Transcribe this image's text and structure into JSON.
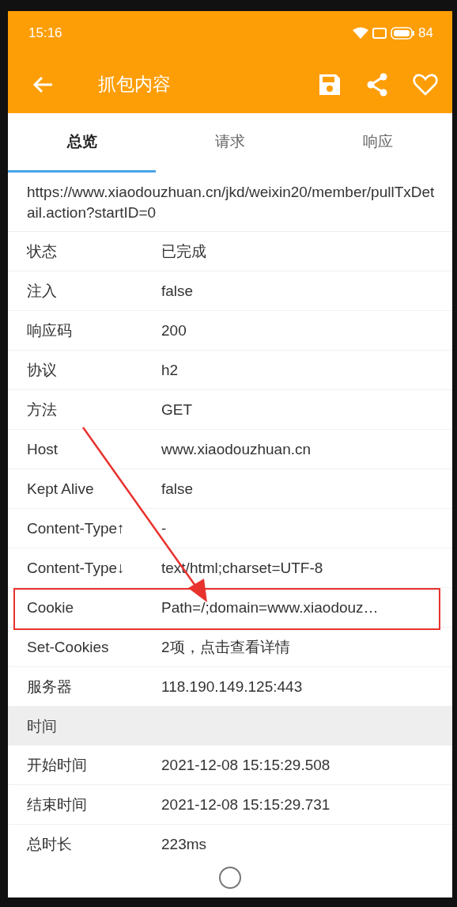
{
  "status_bar": {
    "time": "15:16",
    "battery": "84"
  },
  "toolbar": {
    "title": "抓包内容"
  },
  "tabs": [
    {
      "label": "总览",
      "selected": true
    },
    {
      "label": "请求",
      "selected": false
    },
    {
      "label": "响应",
      "selected": false
    }
  ],
  "url": "https://www.xiaodouzhuan.cn/jkd/weixin20/member/pullTxDetail.action?startID=0",
  "rows": [
    {
      "kind": "field",
      "label": "状态",
      "value": "已完成",
      "highlighted": false
    },
    {
      "kind": "field",
      "label": "注入",
      "value": "false",
      "highlighted": false
    },
    {
      "kind": "field",
      "label": "响应码",
      "value": "200",
      "highlighted": false
    },
    {
      "kind": "field",
      "label": "协议",
      "value": "h2",
      "highlighted": false
    },
    {
      "kind": "field",
      "label": "方法",
      "value": "GET",
      "highlighted": false
    },
    {
      "kind": "field",
      "label": "Host",
      "value": "www.xiaodouzhuan.cn",
      "highlighted": false
    },
    {
      "kind": "field",
      "label": "Kept Alive",
      "value": "false",
      "highlighted": false
    },
    {
      "kind": "field",
      "label": "Content-Type↑",
      "value": "-",
      "highlighted": false
    },
    {
      "kind": "field",
      "label": "Content-Type↓",
      "value": "text/html;charset=UTF-8",
      "highlighted": false
    },
    {
      "kind": "field",
      "label": "Cookie",
      "value": "Path=/;domain=www.xiaodouz…",
      "highlighted": true
    },
    {
      "kind": "field",
      "label": "Set-Cookies",
      "value": "2项，点击查看详情",
      "highlighted": false
    },
    {
      "kind": "field",
      "label": "服务器",
      "value": "118.190.149.125:443",
      "highlighted": false
    },
    {
      "kind": "section",
      "label": "时间"
    },
    {
      "kind": "field",
      "label": "开始时间",
      "value": "2021-12-08 15:15:29.508",
      "highlighted": false
    },
    {
      "kind": "field",
      "label": "结束时间",
      "value": "2021-12-08 15:15:29.731",
      "highlighted": false
    },
    {
      "kind": "field",
      "label": "总时长",
      "value": "223ms",
      "highlighted": false
    }
  ]
}
